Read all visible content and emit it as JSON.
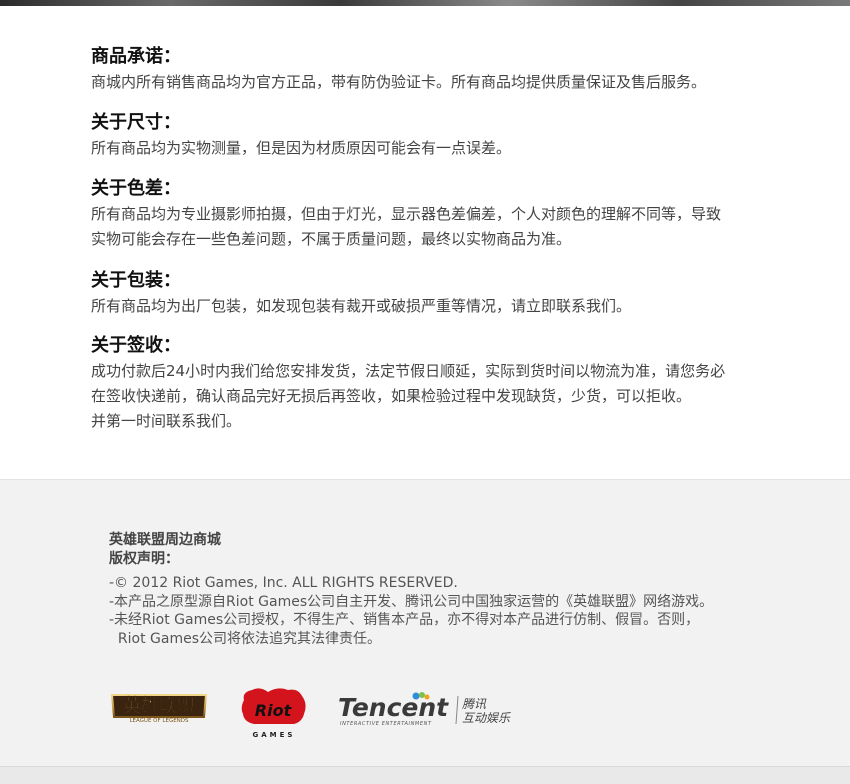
{
  "sections": [
    {
      "title": "商品承诺：",
      "body": [
        "商城内所有销售商品均为官方正品，带有防伪验证卡。所有商品均提供质量保证及售后服务。"
      ]
    },
    {
      "title": "关于尺寸：",
      "body": [
        "所有商品均为实物测量，但是因为材质原因可能会有一点误差。"
      ]
    },
    {
      "title": "关于色差：",
      "body": [
        "所有商品均为专业摄影师拍摄，但由于灯光，显示器色差偏差，个人对颜色的理解不同等，导致",
        "实物可能会存在一些色差问题，不属于质量问题，最终以实物商品为准。"
      ]
    },
    {
      "title": "关于包装：",
      "body": [
        "所有商品均为出厂包装，如发现包装有裁开或破损严重等情况，请立即联系我们。"
      ]
    },
    {
      "title": "关于签收：",
      "body": [
        "成功付款后24小时内我们给您安排发货，法定节假日顺延，实际到货时间以物流为准，请您务必",
        "在签收快递前，确认商品完好无损后再签收，如果检验过程中发现缺货，少货，可以拒收。",
        "并第一时间联系我们。"
      ]
    }
  ],
  "footer": {
    "mall_name": "英雄联盟周边商城",
    "rights_title": "版权声明：",
    "legal": [
      "-© 2012 Riot Games, Inc. ALL RIGHTS RESERVED.",
      "-本产品之原型源自Riot Games公司自主开发、腾讯公司中国独家运营的《英雄联盟》网络游戏。",
      "-未经Riot Games公司授权，不得生产、销售本产品，亦不得对本产品进行仿制、假冒。否则，",
      "  Riot Games公司将依法追究其法律责任。"
    ],
    "logos": {
      "lol": {
        "main": "英雄联盟",
        "sub": "LEAGUE OF LEGENDS"
      },
      "riot": {
        "main": "Riot",
        "sub": "GAMES"
      },
      "tencent": {
        "main": "Tencent",
        "sub": "INTERACTIVE ENTERTAINMENT",
        "cn1": "腾讯",
        "cn2": "互动娱乐"
      }
    }
  },
  "colors": {
    "footer_bg": "#f2f2f2",
    "riot_red": "#d4141c",
    "lol_gold": "#c9a04a"
  }
}
